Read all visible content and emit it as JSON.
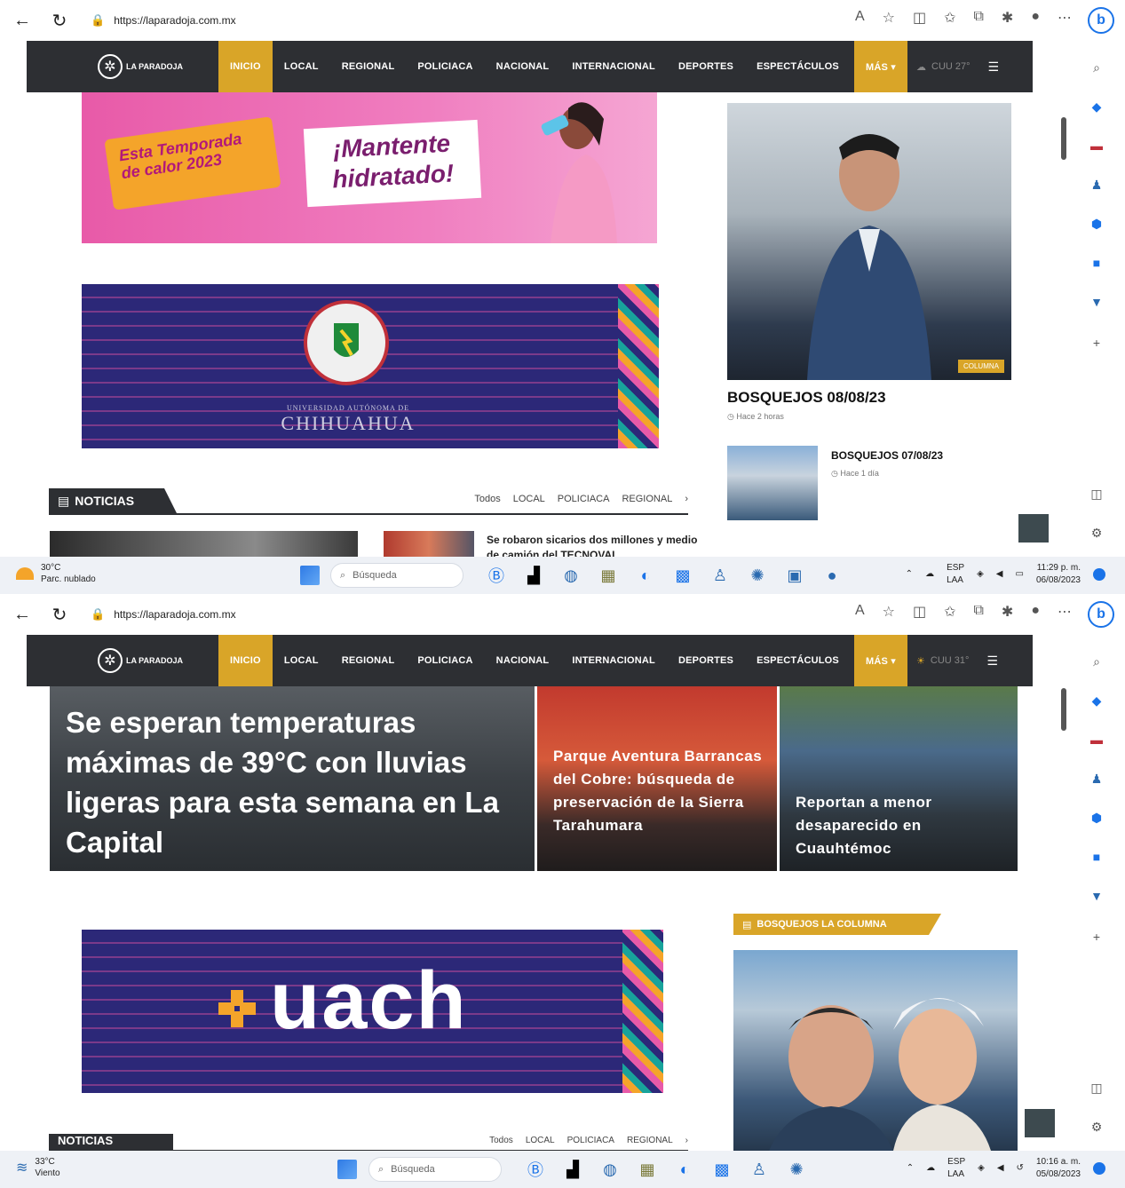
{
  "screen1": {
    "url": "https://laparadoja.com.mx",
    "nav": {
      "logo": "LA PARADOJA",
      "items": [
        "INICIO",
        "LOCAL",
        "REGIONAL",
        "POLICIACA",
        "NACIONAL",
        "INTERNACIONAL",
        "DEPORTES",
        "ESPECTÁCULOS"
      ],
      "more": "MÁS ▾",
      "weather": "CUU 27°"
    },
    "ad_pink": {
      "tag": "Esta Temporada de calor 2023",
      "headline": "¡Mantente hidratado!"
    },
    "ad_uach": {
      "university_small": "UNIVERSIDAD AUTÓNOMA DE",
      "university_big": "CHIHUAHUA"
    },
    "noticias": {
      "label": "NOTICIAS",
      "filters": [
        "Todos",
        "LOCAL",
        "POLICIACA",
        "REGIONAL",
        "›"
      ]
    },
    "strip_headline": "Se robaron sicarios dos millones y medio de camión del TECNOVAL",
    "feature": {
      "badge": "COLUMNA",
      "title": "BOSQUEJOS 08/08/23",
      "time": "Hace 2 horas"
    },
    "feature2": {
      "title": "BOSQUEJOS 07/08/23",
      "time": "Hace 1 día"
    },
    "taskbar": {
      "temp": "30°C",
      "condition": "Parc. nublado",
      "search": "Búsqueda",
      "lang1": "ESP",
      "lang2": "LAA",
      "time": "11:29 p. m.",
      "date": "06/08/2023"
    }
  },
  "screen2": {
    "url": "https://laparadoja.com.mx",
    "nav": {
      "logo": "LA PARADOJA",
      "items": [
        "INICIO",
        "LOCAL",
        "REGIONAL",
        "POLICIACA",
        "NACIONAL",
        "INTERNACIONAL",
        "DEPORTES",
        "ESPECTÁCULOS"
      ],
      "more": "MÁS ▾",
      "weather": "CUU 31°"
    },
    "hero_main": "Se esperan temperaturas máximas de 39°C con lluvias ligeras para esta semana en La Capital",
    "hero_2": "Parque Aventura Barrancas del Cobre: búsqueda de preservación de la Sierra Tarahumara",
    "hero_3": "Reportan a menor desaparecido en Cuauhtémoc",
    "ad_uach_word": "uach",
    "column_head": "BOSQUEJOS LA COLUMNA",
    "noticias": {
      "label": "NOTICIAS",
      "filters": [
        "Todos",
        "LOCAL",
        "POLICIACA",
        "REGIONAL",
        "›"
      ]
    },
    "taskbar": {
      "temp": "33°C",
      "condition": "Viento",
      "search": "Búsqueda",
      "lang1": "ESP",
      "lang2": "LAA",
      "time": "10:16 a. m.",
      "date": "05/08/2023"
    }
  },
  "colors": {
    "nav_bg": "#2d2f33",
    "accent": "#d9a528",
    "uach_blue": "#2c2878",
    "pink": "#e85aa8"
  }
}
